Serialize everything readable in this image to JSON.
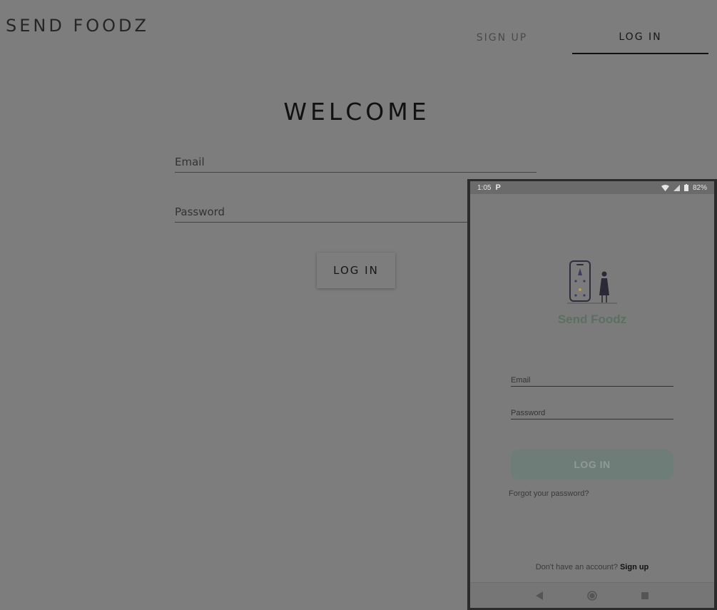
{
  "header": {
    "brand": "SEND FOODZ",
    "tabs": [
      {
        "label": "SIGN UP",
        "active": false
      },
      {
        "label": "LOG IN",
        "active": true
      }
    ]
  },
  "main": {
    "title": "WELCOME",
    "email_placeholder": "Email",
    "password_placeholder": "Password",
    "login_label": "LOG IN"
  },
  "phone": {
    "status": {
      "time": "1:05",
      "notification_glyph": "P",
      "battery": "82%"
    },
    "app_name": "Send Foodz",
    "email_label": "Email",
    "password_label": "Password",
    "login_label": "LOG IN",
    "forgot_label": "Forgot your password?",
    "signup_prompt": "Don't have an account?",
    "signup_link": "Sign up",
    "nav_icons": [
      "back-icon",
      "home-icon",
      "recents-icon"
    ]
  },
  "colors": {
    "overlay_background": "#7d7d7d",
    "app_name": "#5b6f62",
    "phone_button": "#6f7d78"
  }
}
